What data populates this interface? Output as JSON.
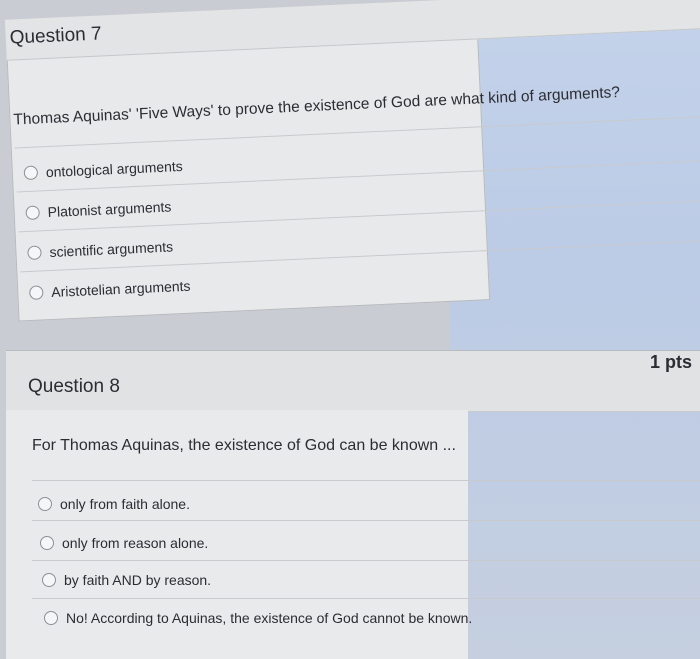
{
  "question7": {
    "title": "Question 7",
    "text": "Thomas Aquinas' 'Five Ways' to prove the existence of God are what kind of arguments?",
    "options": [
      "ontological arguments",
      "Platonist arguments",
      "scientific arguments",
      "Aristotelian arguments"
    ]
  },
  "question8": {
    "title": "Question 8",
    "points": "1 pts",
    "text": "For Thomas Aquinas, the existence of God can be known ...",
    "options": [
      "only from faith alone.",
      "only from reason alone.",
      "by faith AND by reason.",
      "No! According to Aquinas, the existence of God cannot be known."
    ]
  }
}
